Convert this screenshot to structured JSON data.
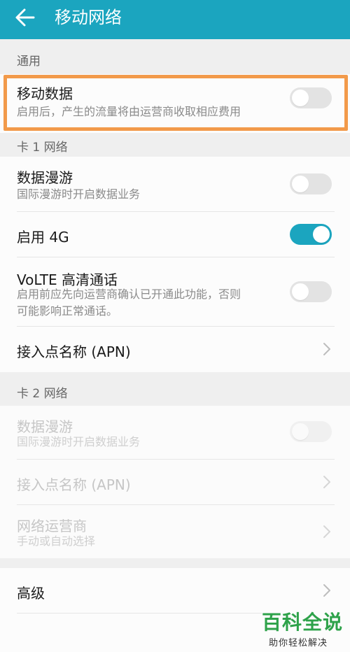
{
  "header": {
    "title": "移动网络"
  },
  "general": {
    "label": "通用",
    "mobile_data": {
      "title": "移动数据",
      "subtitle": "启用后，产生的流量将由运营商收取相应费用",
      "enabled": false
    }
  },
  "sim1": {
    "label": "卡 1 网络",
    "roaming": {
      "title": "数据漫游",
      "subtitle": "国际漫游时开启数据业务",
      "enabled": false
    },
    "enable_4g": {
      "title": "启用 4G",
      "enabled": true
    },
    "volte": {
      "title": "VoLTE 高清通话",
      "subtitle_line1": "启用前应先向运营商确认已开通此功能，否则",
      "subtitle_line2": "可能影响正常通话。",
      "enabled": false
    },
    "apn": {
      "title": "接入点名称 (APN)"
    }
  },
  "sim2": {
    "label": "卡 2 网络",
    "roaming": {
      "title": "数据漫游",
      "subtitle": "国际漫游时开启数据业务",
      "enabled": false
    },
    "apn": {
      "title": "接入点名称 (APN)"
    },
    "operator": {
      "title": "网络运营商",
      "subtitle": "手动或自动选择"
    }
  },
  "advanced": {
    "title": "高级"
  },
  "watermark": {
    "main": "百科全说",
    "sub": "助你轻松解决"
  },
  "colors": {
    "accent": "#1ba5bf",
    "highlight": "#f29a4a",
    "watermark": "#2ea24a"
  }
}
